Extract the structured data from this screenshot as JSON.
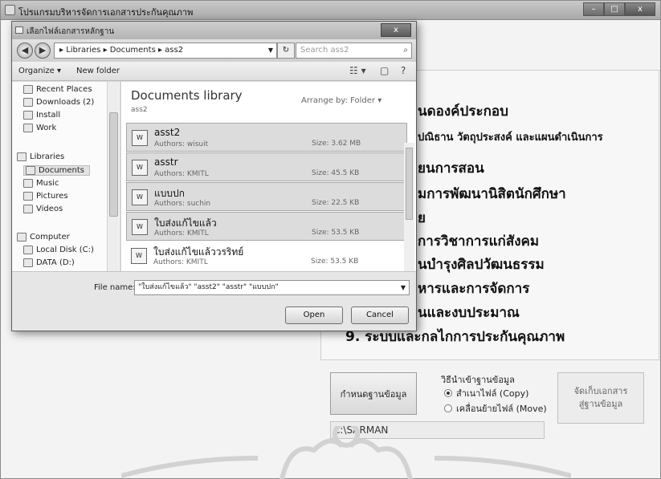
{
  "main_window": {
    "title": "โปรแกรมบริหารจัดการเอกสารประกันคุณภาพ",
    "minimize": "–",
    "maximize": "□",
    "close": "x"
  },
  "outline": [
    "นดองค์ประกอบ",
    "ปณิธาน วัตถุประสงค์ และแผนดำเนินการ",
    "ยนการสอน",
    "มการพัฒนานิสิตนักศึกษา",
    "ย",
    "การวิชาการแก่สังคม",
    "นบำรุงศิลปวัฒนธรรม",
    "หารและการจัดการ",
    "นและงบประมาณ",
    "9. ระบบและกลไกการประกันคุณภาพ"
  ],
  "import_group": {
    "title": "วิธีนำเข้าฐานข้อมูล",
    "options": [
      {
        "label": "สำเนาไฟล์ (Copy)",
        "checked": true
      },
      {
        "label": "เคลื่อนย้ายไฟล์ (Move)",
        "checked": false
      }
    ]
  },
  "set_db_button": "กำหนดฐานข้อมูล",
  "save_button": "จัดเก็บเอกสาร\nสู่ฐานข้อมูล",
  "path_value": "C:\\SARMAN",
  "dialog": {
    "title": "เลือกไฟล์เอกสารหลักฐาน",
    "close": "x",
    "address": "▸ Libraries ▸ Documents ▸ ass2",
    "search_placeholder": "Search ass2",
    "toolbar": {
      "organize": "Organize ▾",
      "new_folder": "New folder"
    },
    "nav_items": [
      {
        "label": "Recent Places",
        "icon": "recent-places-icon"
      },
      {
        "label": "Downloads (2)",
        "icon": "downloads-icon"
      },
      {
        "label": "Install",
        "icon": "folder-icon"
      },
      {
        "label": "Work",
        "icon": "folder-icon"
      },
      {
        "label": "Libraries",
        "icon": "libraries-icon"
      },
      {
        "label": "Documents",
        "icon": "documents-icon"
      },
      {
        "label": "Music",
        "icon": "music-icon"
      },
      {
        "label": "Pictures",
        "icon": "pictures-icon"
      },
      {
        "label": "Videos",
        "icon": "videos-icon"
      },
      {
        "label": "Computer",
        "icon": "computer-icon"
      },
      {
        "label": "Local Disk (C:)",
        "icon": "disk-icon"
      },
      {
        "label": "DATA (D:)",
        "icon": "disk-icon"
      }
    ],
    "library_title": "Documents library",
    "library_sub": "ass2",
    "arrange_label": "Arrange by:",
    "arrange_value": "Folder ▾",
    "files": [
      {
        "name": "asst2",
        "author": "Authors: wisuit",
        "size": "Size: 3.62 MB",
        "selected": true
      },
      {
        "name": "asstr",
        "author": "Authors: KMITL",
        "size": "Size: 45.5 KB",
        "selected": true
      },
      {
        "name": "แบบปก",
        "author": "Authors: suchin",
        "size": "Size: 22.5 KB",
        "selected": true
      },
      {
        "name": "ใบส่งแก้ไขแล้ว",
        "author": "Authors: KMITL",
        "size": "Size: 53.5 KB",
        "selected": true
      },
      {
        "name": "ใบส่งแก้ไขแล้ววรริทย์",
        "author": "Authors: KMITL",
        "size": "Size: 53.5 KB",
        "selected": false
      }
    ],
    "file_name_label": "File name:",
    "file_name_value": "\"ใบส่งแก้ไขแล้ว\" \"asst2\" \"asstr\" \"แบบปก\"",
    "open_button": "Open",
    "cancel_button": "Cancel"
  }
}
